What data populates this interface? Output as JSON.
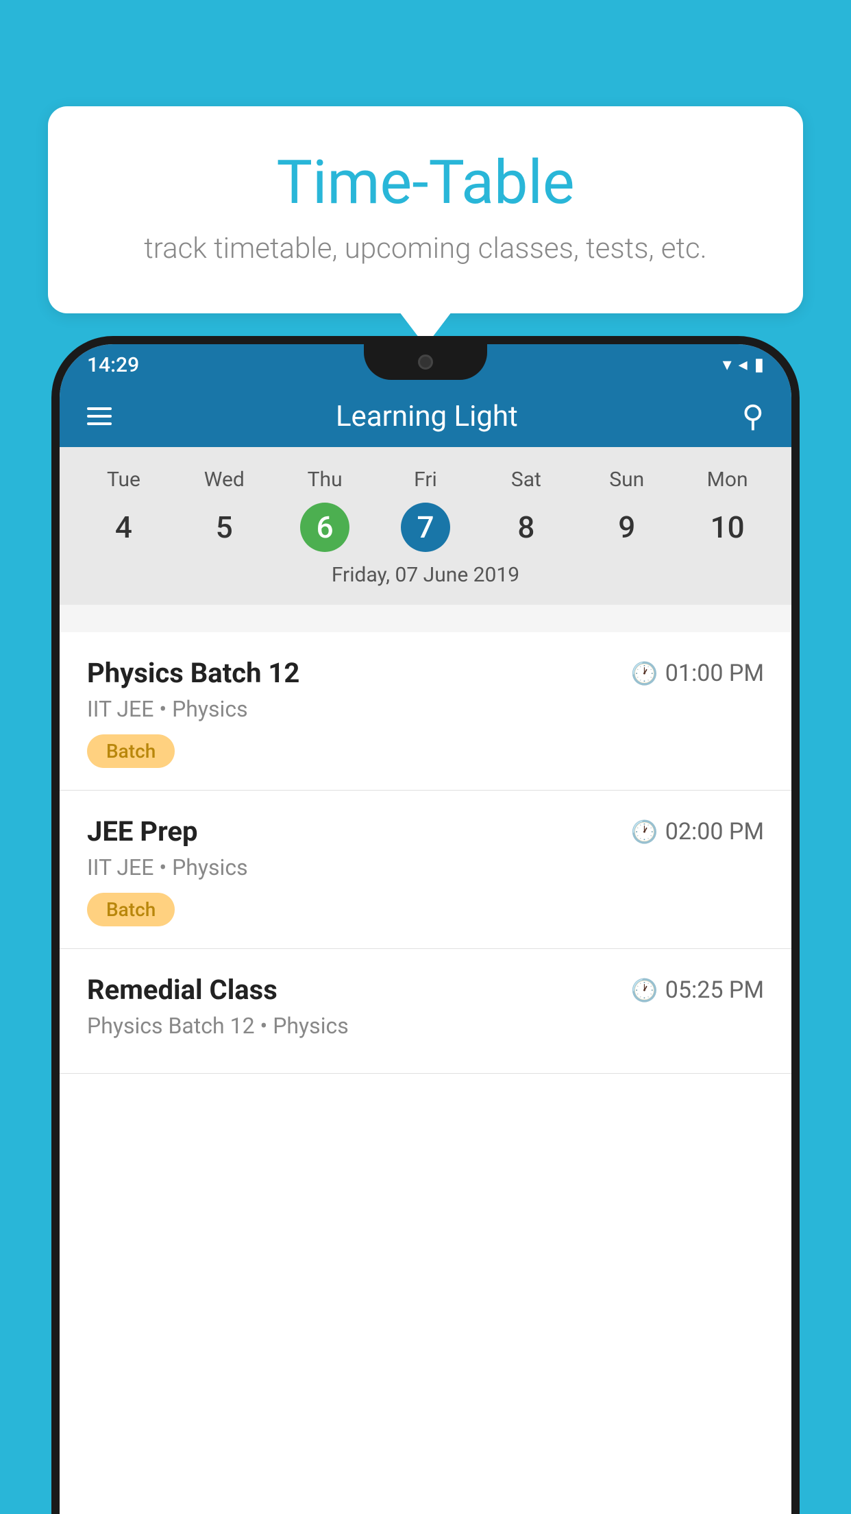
{
  "background": {
    "color": "#29b6d8"
  },
  "speechBubble": {
    "title": "Time-Table",
    "subtitle": "track timetable, upcoming classes, tests, etc."
  },
  "statusBar": {
    "time": "14:29"
  },
  "appHeader": {
    "title": "Learning Light"
  },
  "calendar": {
    "days": [
      {
        "name": "Tue",
        "num": "4",
        "state": "normal"
      },
      {
        "name": "Wed",
        "num": "5",
        "state": "normal"
      },
      {
        "name": "Thu",
        "num": "6",
        "state": "today"
      },
      {
        "name": "Fri",
        "num": "7",
        "state": "selected"
      },
      {
        "name": "Sat",
        "num": "8",
        "state": "normal"
      },
      {
        "name": "Sun",
        "num": "9",
        "state": "normal"
      },
      {
        "name": "Mon",
        "num": "10",
        "state": "normal"
      }
    ],
    "selectedDateLabel": "Friday, 07 June 2019"
  },
  "schedule": {
    "items": [
      {
        "title": "Physics Batch 12",
        "time": "01:00 PM",
        "subtitle": "IIT JEE • Physics",
        "badge": "Batch"
      },
      {
        "title": "JEE Prep",
        "time": "02:00 PM",
        "subtitle": "IIT JEE • Physics",
        "badge": "Batch"
      },
      {
        "title": "Remedial Class",
        "time": "05:25 PM",
        "subtitle": "Physics Batch 12 • Physics",
        "badge": null
      }
    ]
  }
}
